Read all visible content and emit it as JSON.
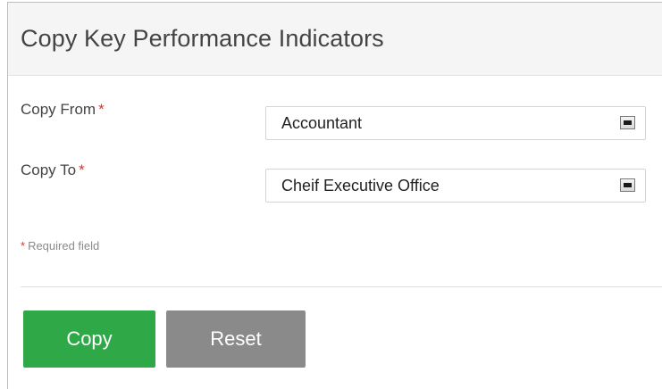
{
  "header": {
    "title": "Copy Key Performance Indicators"
  },
  "form": {
    "copy_from": {
      "label": "Copy From",
      "required_mark": "*",
      "value": "Accountant"
    },
    "copy_to": {
      "label": "Copy To",
      "required_mark": "*",
      "value": "Cheif Executive Office"
    },
    "required_note": {
      "mark": "*",
      "text": "Required field"
    }
  },
  "actions": {
    "copy_label": "Copy",
    "reset_label": "Reset"
  },
  "colors": {
    "copy_button": "#2fa947",
    "reset_button": "#8a8a8a",
    "required_mark": "#d9372b"
  },
  "icons": {
    "select_arrow": "chevron-down-icon"
  }
}
